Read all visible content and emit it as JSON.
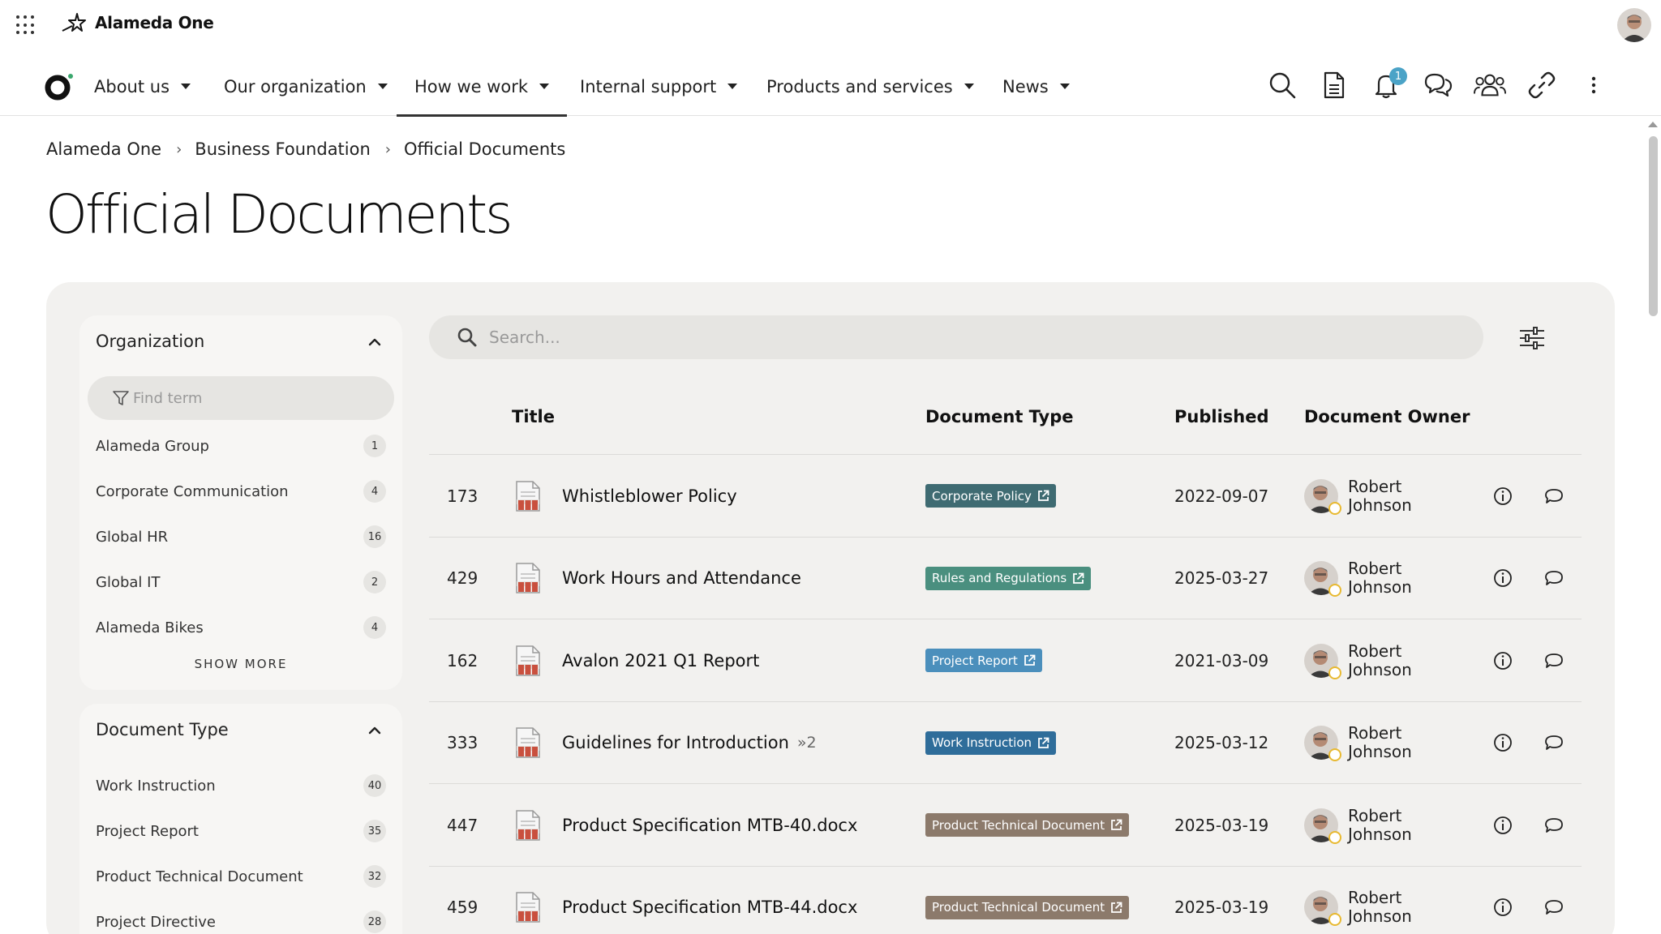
{
  "brand": {
    "name": "Alameda One"
  },
  "nav": {
    "items": [
      {
        "label": "About us"
      },
      {
        "label": "Our organization"
      },
      {
        "label": "How we work"
      },
      {
        "label": "Internal support"
      },
      {
        "label": "Products and services"
      },
      {
        "label": "News"
      }
    ],
    "active": "How we work",
    "notification_count": "1",
    "icons": [
      "search-icon",
      "document-icon",
      "bell-icon",
      "chat-icon",
      "people-icon",
      "link-icon",
      "more-vertical-icon"
    ]
  },
  "breadcrumb": [
    "Alameda One",
    "Business Foundation",
    "Official Documents"
  ],
  "page": {
    "title": "Official Documents"
  },
  "facets": {
    "organization": {
      "heading": "Organization",
      "find_placeholder": "Find term",
      "items": [
        {
          "label": "Alameda Group",
          "count": "1"
        },
        {
          "label": "Corporate Communication",
          "count": "4"
        },
        {
          "label": "Global HR",
          "count": "16"
        },
        {
          "label": "Global IT",
          "count": "2"
        },
        {
          "label": "Alameda Bikes",
          "count": "4"
        }
      ],
      "show_more": "SHOW MORE"
    },
    "document_type": {
      "heading": "Document Type",
      "items": [
        {
          "label": "Work Instruction",
          "count": "40"
        },
        {
          "label": "Project Report",
          "count": "35"
        },
        {
          "label": "Product Technical Document",
          "count": "32"
        },
        {
          "label": "Project Directive",
          "count": "28"
        }
      ]
    }
  },
  "search": {
    "placeholder": "Search..."
  },
  "table": {
    "headers": {
      "title": "Title",
      "type": "Document Type",
      "published": "Published",
      "owner": "Document Owner"
    },
    "rows": [
      {
        "id": "173",
        "title": "Whistleblower Policy",
        "versions": "",
        "type": "Corporate Policy",
        "type_color": "#3f6b72",
        "published": "2022-09-07",
        "owner": "Robert Johnson"
      },
      {
        "id": "429",
        "title": "Work Hours and Attendance",
        "versions": "",
        "type": "Rules and Regulations",
        "type_color": "#4a8f7f",
        "published": "2025-03-27",
        "owner": "Robert Johnson"
      },
      {
        "id": "162",
        "title": "Avalon 2021 Q1 Report",
        "versions": "",
        "type": "Project Report",
        "type_color": "#4b8fbc",
        "published": "2021-03-09",
        "owner": "Robert Johnson"
      },
      {
        "id": "333",
        "title": "Guidelines for Introduction",
        "versions": "»2",
        "type": "Work Instruction",
        "type_color": "#2f6d9a",
        "published": "2025-03-12",
        "owner": "Robert Johnson"
      },
      {
        "id": "447",
        "title": "Product Specification MTB-40.docx",
        "versions": "",
        "type": "Product Technical Document",
        "type_color": "#8c7a6b",
        "published": "2025-03-19",
        "owner": "Robert Johnson"
      },
      {
        "id": "459",
        "title": "Product Specification MTB-44.docx",
        "versions": "",
        "type": "Product Technical Document",
        "type_color": "#8c7a6b",
        "published": "2025-03-19",
        "owner": "Robert Johnson"
      }
    ]
  }
}
